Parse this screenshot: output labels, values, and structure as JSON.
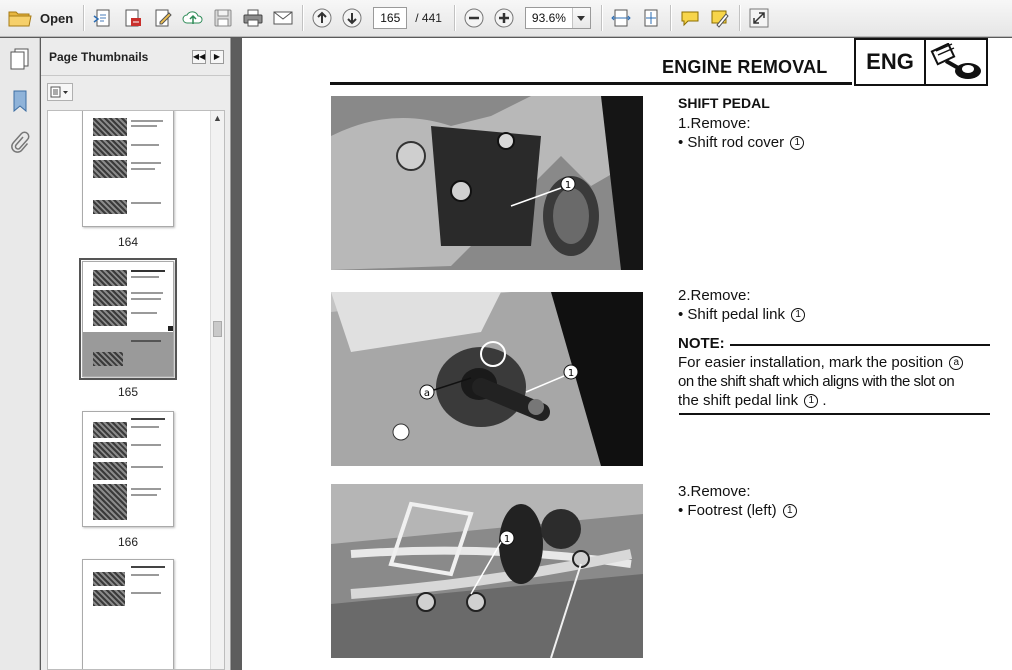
{
  "toolbar": {
    "open_label": "Open",
    "current_page": "165",
    "total_pages": "/ 441",
    "zoom": "93.6%"
  },
  "panel": {
    "title": "Page Thumbnails",
    "thumbnails": [
      {
        "label": "164"
      },
      {
        "label": "165"
      },
      {
        "label": "166"
      }
    ]
  },
  "document": {
    "header_title": "ENGINE REMOVAL",
    "badge": "ENG",
    "section_title": "SHIFT PEDAL",
    "step1": {
      "title": "1.Remove:",
      "item": "• Shift rod cover",
      "ref": "1"
    },
    "step2": {
      "title": "2.Remove:",
      "item": "• Shift pedal link",
      "ref": "1"
    },
    "note": {
      "label": "NOTE:",
      "line1": "For easier installation, mark the position",
      "ref_a": "a",
      "line2": "on the shift shaft which aligns with the slot on",
      "line3": "the shift pedal link",
      "ref_1": "1",
      "end": "."
    },
    "step3": {
      "title": "3.Remove:",
      "item": "• Footrest (left)",
      "ref": "1"
    },
    "photo_callouts": {
      "one": "1",
      "a": "a"
    }
  }
}
